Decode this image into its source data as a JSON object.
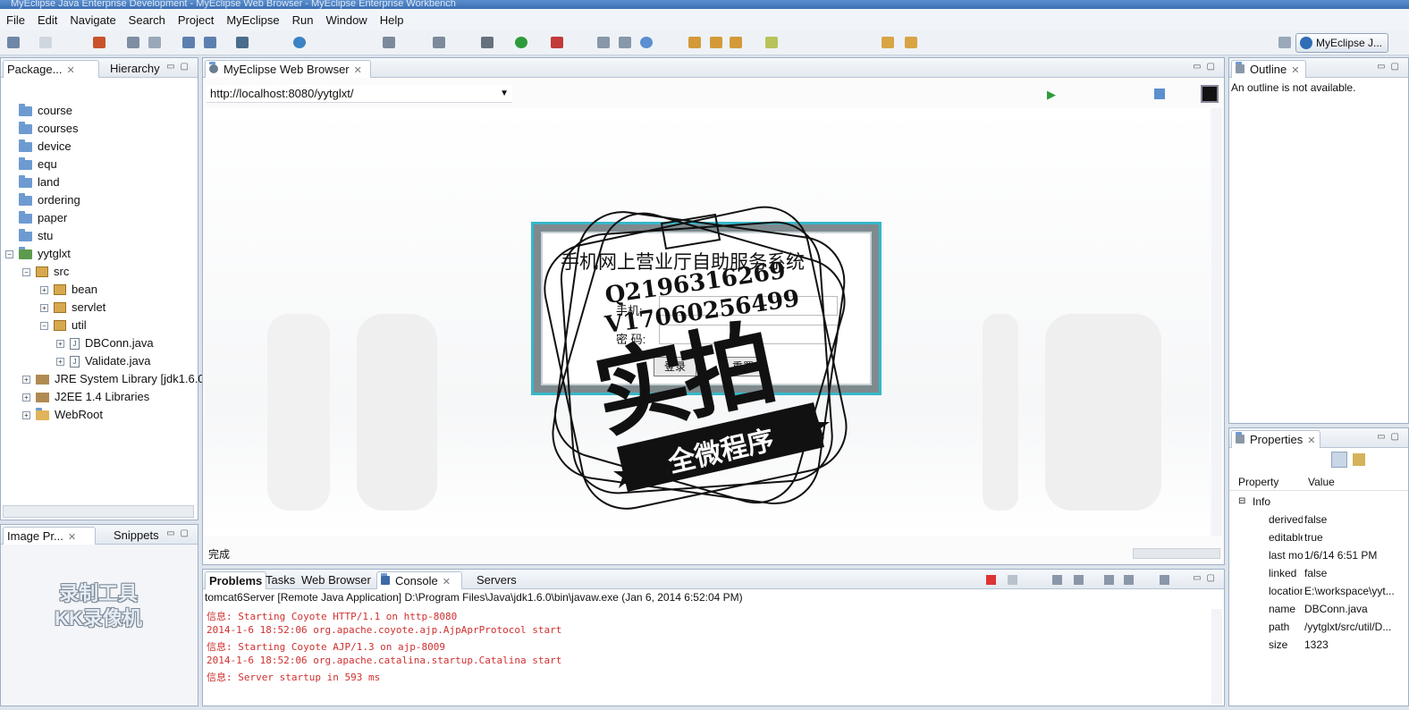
{
  "window": {
    "title": "MyEclipse Java Enterprise Development - MyEclipse Web Browser - MyEclipse Enterprise Workbench"
  },
  "menu": [
    "File",
    "Edit",
    "Navigate",
    "Search",
    "Project",
    "MyEclipse",
    "Run",
    "Window",
    "Help"
  ],
  "perspective": {
    "label": "MyEclipse J..."
  },
  "package_explorer": {
    "tabs": [
      "Package...",
      "Hierarchy"
    ],
    "items": [
      "course",
      "courses",
      "device",
      "equ",
      "land",
      "ordering",
      "paper",
      "stu",
      "yytglxt",
      "src",
      "bean",
      "servlet",
      "util",
      "DBConn.java",
      "Validate.java",
      "JRE System Library [jdk1.6.0",
      "J2EE 1.4 Libraries",
      "WebRoot"
    ]
  },
  "image_panel": {
    "tabs": [
      "Image Pr...",
      "Snippets"
    ],
    "watermark": [
      "录制工具",
      "KK录像机"
    ]
  },
  "browser": {
    "tab": "MyEclipse Web Browser",
    "url": "http://localhost:8080/yytglxt/",
    "status": "完成",
    "login": {
      "title": "手机网上营业厅自助服务系统",
      "user_label": "手机:",
      "pass_label": "密 码:",
      "login_btn": "登录",
      "reset_btn": "重置"
    }
  },
  "stamp": {
    "line1": "Q2196316269",
    "line2": "V17060256499",
    "big": "实拍",
    "banner": "全微程序"
  },
  "outline": {
    "tab": "Outline",
    "message": "An outline is not available."
  },
  "properties": {
    "tab": "Properties",
    "headers": [
      "Property",
      "Value"
    ],
    "group": "Info",
    "rows": [
      {
        "k": "derived",
        "v": "false"
      },
      {
        "k": "editable",
        "v": "true"
      },
      {
        "k": "last modified",
        "v": "1/6/14 6:51 PM"
      },
      {
        "k": "linked",
        "v": "false"
      },
      {
        "k": "location",
        "v": "E:\\workspace\\yyt..."
      },
      {
        "k": "name",
        "v": "DBConn.java"
      },
      {
        "k": "path",
        "v": "/yytglxt/src/util/D..."
      },
      {
        "k": "size",
        "v": "1323"
      }
    ]
  },
  "bottom": {
    "tabs": [
      "Problems",
      "Tasks",
      "Web Browser",
      "Console",
      "Servers"
    ],
    "console_header": "tomcat6Server [Remote Java Application] D:\\Program Files\\Java\\jdk1.6.0\\bin\\javaw.exe (Jan 6, 2014 6:52:04 PM)",
    "lines": [
      "信息: Starting Coyote HTTP/1.1 on http-8080",
      "2014-1-6 18:52:06 org.apache.coyote.ajp.AjpAprProtocol start",
      "信息: Starting Coyote AJP/1.3 on ajp-8009",
      "2014-1-6 18:52:06 org.apache.catalina.startup.Catalina start",
      "信息: Server startup in 593 ms"
    ]
  },
  "colors": {
    "accent": "#2f6db5",
    "console_text": "#d03030",
    "login_border": "#37b7c9"
  }
}
